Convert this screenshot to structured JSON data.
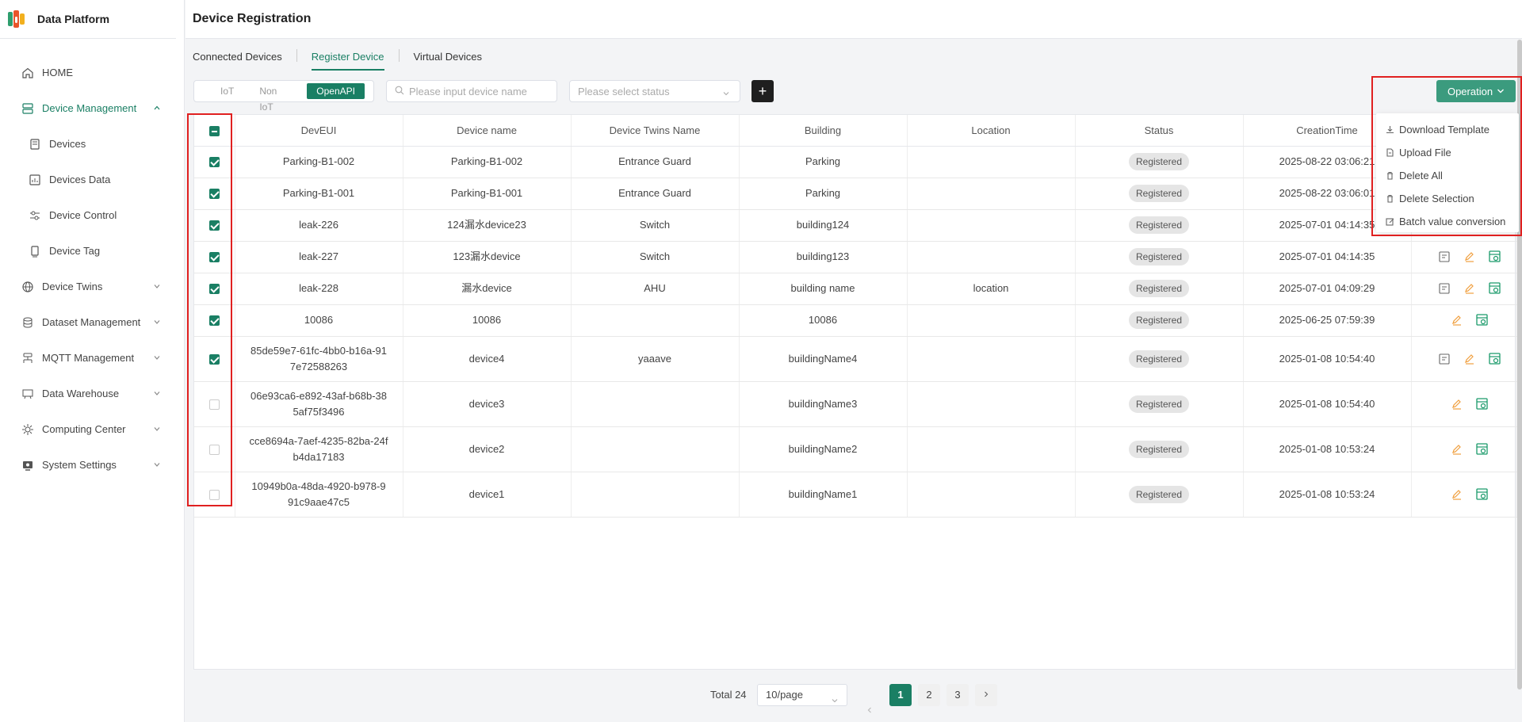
{
  "brand": {
    "name": "Data Platform"
  },
  "sidebar": {
    "items": [
      {
        "label": "HOME",
        "icon": "home-icon"
      },
      {
        "label": "Device Management",
        "icon": "server-icon",
        "expanded": true
      },
      {
        "label": "Devices",
        "icon": "devices-icon"
      },
      {
        "label": "Devices Data",
        "icon": "data-icon"
      },
      {
        "label": "Device Control",
        "icon": "control-icon"
      },
      {
        "label": "Device Tag",
        "icon": "tag-icon"
      },
      {
        "label": "Device Twins",
        "icon": "twins-icon"
      },
      {
        "label": "Dataset Management",
        "icon": "database-icon"
      },
      {
        "label": "MQTT Management",
        "icon": "mqtt-icon"
      },
      {
        "label": "Data Warehouse",
        "icon": "warehouse-icon"
      },
      {
        "label": "Computing Center",
        "icon": "computing-icon"
      },
      {
        "label": "System Settings",
        "icon": "settings-icon"
      }
    ]
  },
  "header": {
    "title": "Device Registration"
  },
  "tabs": [
    {
      "label": "Connected Devices"
    },
    {
      "label": "Register Device",
      "active": true
    },
    {
      "label": "Virtual Devices"
    }
  ],
  "toolbar": {
    "segments": [
      "IoT",
      "Non IoT",
      "OpenAPI"
    ],
    "active_segment": "OpenAPI",
    "search_placeholder": "Please input device name",
    "status_placeholder": "Please select status",
    "plus_label": "+",
    "operation_label": "Operation"
  },
  "operation_menu": [
    {
      "label": "Download Template",
      "icon": "download-icon"
    },
    {
      "label": "Upload File",
      "icon": "file-icon"
    },
    {
      "label": "Delete All",
      "icon": "trash-icon"
    },
    {
      "label": "Delete Selection",
      "icon": "trash-icon"
    },
    {
      "label": "Batch value conversion",
      "icon": "edit-icon"
    }
  ],
  "table": {
    "columns": [
      "DevEUI",
      "Device name",
      "Device Twins Name",
      "Building",
      "Location",
      "Status",
      "CreationTime"
    ],
    "rows": [
      {
        "checked": true,
        "deveui": "Parking-B1-002",
        "name": "Parking-B1-002",
        "twins": "Entrance Guard",
        "building": "Parking",
        "location": "",
        "status": "Registered",
        "time": "2025-08-22 03:06:21"
      },
      {
        "checked": true,
        "deveui": "Parking-B1-001",
        "name": "Parking-B1-001",
        "twins": "Entrance Guard",
        "building": "Parking",
        "location": "",
        "status": "Registered",
        "time": "2025-08-22 03:06:01"
      },
      {
        "checked": true,
        "deveui": "leak-226",
        "name": "124漏水device23",
        "twins": "Switch",
        "building": "building124",
        "location": "",
        "status": "Registered",
        "time": "2025-07-01 04:14:35"
      },
      {
        "checked": true,
        "deveui": "leak-227",
        "name": "123漏水device",
        "twins": "Switch",
        "building": "building123",
        "location": "",
        "status": "Registered",
        "time": "2025-07-01 04:14:35"
      },
      {
        "checked": true,
        "deveui": "leak-228",
        "name": "漏水device",
        "twins": "AHU",
        "building": "building name",
        "location": "location",
        "status": "Registered",
        "time": "2025-07-01 04:09:29"
      },
      {
        "checked": true,
        "deveui": "10086",
        "name": "10086",
        "twins": "",
        "building": "10086",
        "location": "",
        "status": "Registered",
        "time": "2025-06-25 07:59:39"
      },
      {
        "checked": true,
        "deveui": "85de59e7-61fc-4bb0-b16a-917e72588263",
        "name": "device4",
        "twins": "yaaave",
        "building": "buildingName4",
        "location": "",
        "status": "Registered",
        "time": "2025-01-08 10:54:40"
      },
      {
        "checked": false,
        "deveui": "06e93ca6-e892-43af-b68b-385af75f3496",
        "name": "device3",
        "twins": "",
        "building": "buildingName3",
        "location": "",
        "status": "Registered",
        "time": "2025-01-08 10:54:40"
      },
      {
        "checked": false,
        "deveui": "cce8694a-7aef-4235-82ba-24fb4da17183",
        "name": "device2",
        "twins": "",
        "building": "buildingName2",
        "location": "",
        "status": "Registered",
        "time": "2025-01-08 10:53:24"
      },
      {
        "checked": false,
        "deveui": "10949b0a-48da-4920-b978-991c9aae47c5",
        "name": "device1",
        "twins": "",
        "building": "buildingName1",
        "location": "",
        "status": "Registered",
        "time": "2025-01-08 10:53:24"
      }
    ]
  },
  "pagination": {
    "total": "Total 24",
    "page_size": "10/page",
    "pages": [
      "1",
      "2",
      "3"
    ],
    "current": "1"
  },
  "colors": {
    "accent": "#1a7f64",
    "operation": "#3b9b7e",
    "highlight": "#e02020"
  }
}
